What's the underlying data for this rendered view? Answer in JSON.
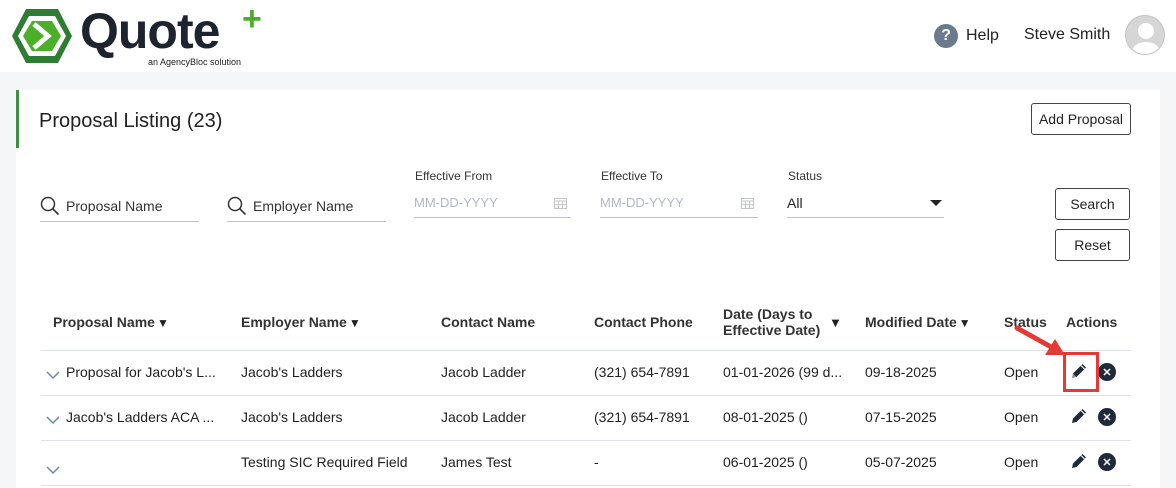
{
  "header": {
    "logo_text": "Quote",
    "logo_plus": "+",
    "logo_tagline": "an AgencyBloc solution",
    "help_label": "Help",
    "user_name": "Steve Smith"
  },
  "page": {
    "title": "Proposal Listing (23)",
    "add_button": "Add Proposal"
  },
  "filters": {
    "proposal_name_placeholder": "Proposal Name",
    "employer_name_placeholder": "Employer Name",
    "effective_from_label": "Effective From",
    "effective_from_placeholder": "MM-DD-YYYY",
    "effective_to_label": "Effective To",
    "effective_to_placeholder": "MM-DD-YYYY",
    "status_label": "Status",
    "status_value": "All",
    "search_button": "Search",
    "reset_button": "Reset"
  },
  "table": {
    "columns": {
      "proposal_name": "Proposal Name",
      "employer_name": "Employer Name",
      "contact_name": "Contact Name",
      "contact_phone": "Contact Phone",
      "date_line1": "Date (Days to",
      "date_line2": "Effective Date)",
      "modified_date": "Modified Date",
      "status": "Status",
      "actions": "Actions"
    },
    "sort_glyph": "▼",
    "rows": [
      {
        "proposal_name": "Proposal for Jacob's L...",
        "employer_name": "Jacob's Ladders",
        "contact_name": "Jacob Ladder",
        "contact_phone": "(321) 654-7891",
        "date": "01-01-2026 (99 d...",
        "modified_date": "09-18-2025",
        "status": "Open"
      },
      {
        "proposal_name": "Jacob's Ladders ACA ...",
        "employer_name": "Jacob's Ladders",
        "contact_name": "Jacob Ladder",
        "contact_phone": "(321) 654-7891",
        "date": "08-01-2025 ()",
        "modified_date": "07-15-2025",
        "status": "Open"
      },
      {
        "proposal_name": "",
        "employer_name": "Testing SIC Required Field",
        "contact_name": "James Test",
        "contact_phone": "-",
        "date": "06-01-2025 ()",
        "modified_date": "05-07-2025",
        "status": "Open"
      }
    ]
  },
  "colors": {
    "accent_green": "#3e8e41",
    "logo_green": "#4caf2a",
    "highlight_red": "#e53935",
    "action_dark": "#1f2a3c"
  },
  "icons": {
    "help": "question-circle-icon",
    "search": "search-icon",
    "calendar": "calendar-icon",
    "expand": "chevron-down-icon",
    "edit": "pencil-icon",
    "delete": "close-circle-icon",
    "x_glyph": "✕",
    "help_glyph": "?"
  }
}
